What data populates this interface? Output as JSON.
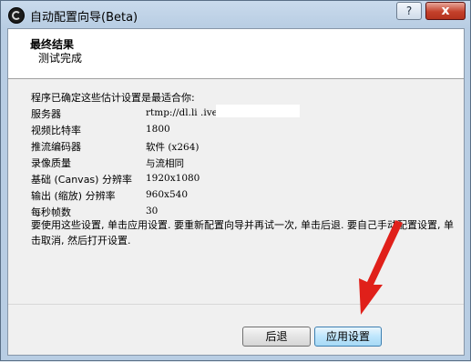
{
  "window": {
    "title": "自动配置向导(Beta)",
    "help_label": "?",
    "close_label": "x"
  },
  "header": {
    "title": "最终结果",
    "subtitle": "测试完成"
  },
  "intro": "程序已确定这些估计设置是最适合你:",
  "settings": [
    {
      "label": "服务器",
      "value": "rtmp://dl.li                 .ive-dl/"
    },
    {
      "label": "视频比特率",
      "value": "1800"
    },
    {
      "label": "推流编码器",
      "value": "软件 (x264)"
    },
    {
      "label": "录像质量",
      "value": "与流相同"
    },
    {
      "label": "基础 (Canvas) 分辨率",
      "value": "1920x1080"
    },
    {
      "label": "输出 (缩放) 分辨率",
      "value": "960x540"
    },
    {
      "label": "每秒帧数",
      "value": "30"
    }
  ],
  "note": "要使用这些设置, 单击应用设置. 要重新配置向导并再试一次, 单击后退. 要自己手动配置设置, 单击取消, 然后打开设置.",
  "buttons": {
    "back_label": "后退",
    "apply_label": "应用设置"
  },
  "colors": {
    "annotation_arrow": "#e0201a"
  }
}
